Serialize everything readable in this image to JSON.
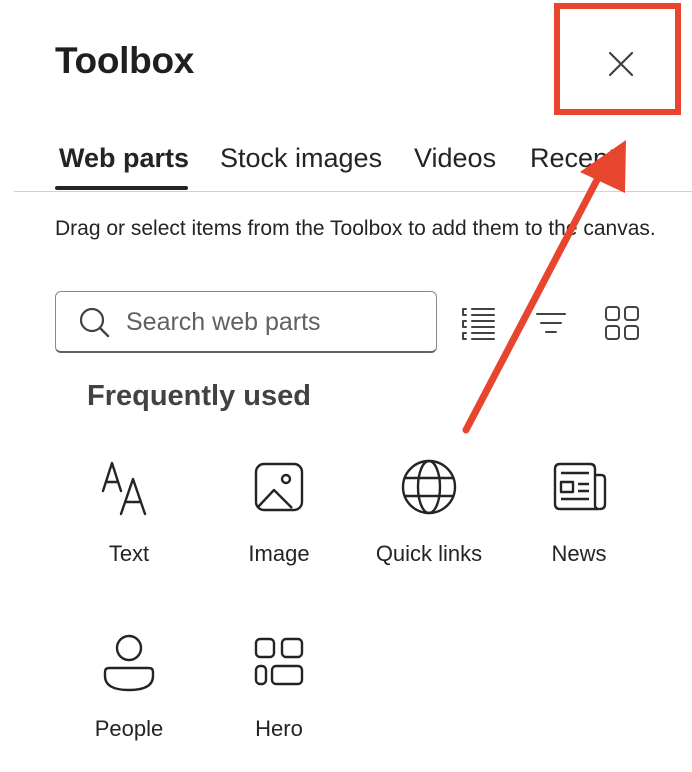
{
  "panel": {
    "title": "Toolbox",
    "close_icon": "close-icon"
  },
  "tabs": [
    {
      "label": "Web parts",
      "active": true
    },
    {
      "label": "Stock images",
      "active": false
    },
    {
      "label": "Videos",
      "active": false
    },
    {
      "label": "Recent",
      "active": false
    }
  ],
  "description": "Drag or select items from the Toolbox to add them to the canvas.",
  "search": {
    "placeholder": "Search web parts",
    "value": ""
  },
  "view_controls": [
    {
      "name": "list-view-icon"
    },
    {
      "name": "sort-filter-icon"
    },
    {
      "name": "grid-view-icon"
    }
  ],
  "section": {
    "title": "Frequently used",
    "items": [
      {
        "label": "Text",
        "icon": "text-icon"
      },
      {
        "label": "Image",
        "icon": "image-icon"
      },
      {
        "label": "Quick links",
        "icon": "globe-icon"
      },
      {
        "label": "News",
        "icon": "news-icon"
      },
      {
        "label": "People",
        "icon": "person-icon"
      },
      {
        "label": "Hero",
        "icon": "hero-grid-icon"
      }
    ]
  },
  "annotation": {
    "highlight_color": "#e8452e"
  }
}
